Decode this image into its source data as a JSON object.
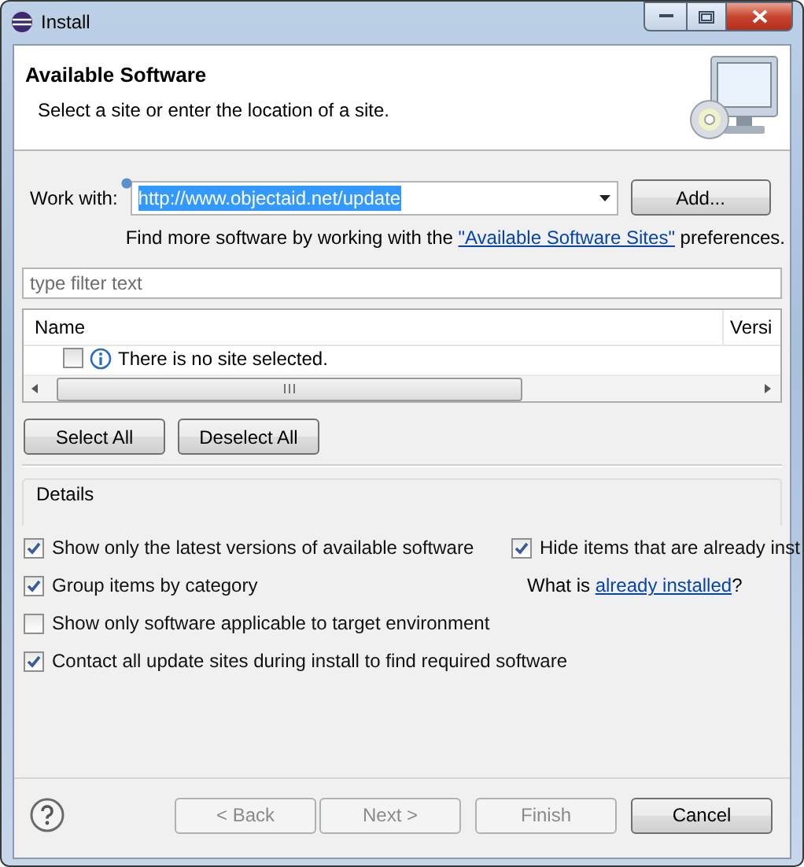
{
  "window": {
    "title": "Install"
  },
  "header": {
    "title": "Available Software",
    "subtitle": "Select a site or enter the location of a site."
  },
  "work_with": {
    "label": "Work with:",
    "value": "http://www.objectaid.net/update",
    "add_button": "Add..."
  },
  "hint": {
    "before": "Find more software by working with the",
    "link": "\"Available Software Sites\"",
    "after": "preferences."
  },
  "filter": {
    "placeholder": "type filter text"
  },
  "tree": {
    "columns": [
      "Name",
      "Versi"
    ],
    "rows": [
      {
        "label": "There is no site selected.",
        "checked": false
      }
    ]
  },
  "selection_buttons": [
    "Select All",
    "Deselect All"
  ],
  "details": {
    "label": "Details"
  },
  "options_left": [
    {
      "label": "Show only the latest versions of available software",
      "checked": true
    },
    {
      "label": "Group items by category",
      "checked": true
    },
    {
      "label": "Show only software applicable to target environment",
      "checked": false
    },
    {
      "label": "Contact all update sites during install to find required software",
      "checked": true
    }
  ],
  "options_right": [
    {
      "label": "Hide items that are already inst",
      "checked": true
    }
  ],
  "installed_note": {
    "before": "What is",
    "link": "already installed",
    "after": "?"
  },
  "footer_buttons": [
    {
      "label": "< Back",
      "disabled": true
    },
    {
      "label": "Next >",
      "disabled": true
    },
    {
      "label": "Finish",
      "disabled": true
    },
    {
      "label": "Cancel",
      "disabled": false
    }
  ]
}
